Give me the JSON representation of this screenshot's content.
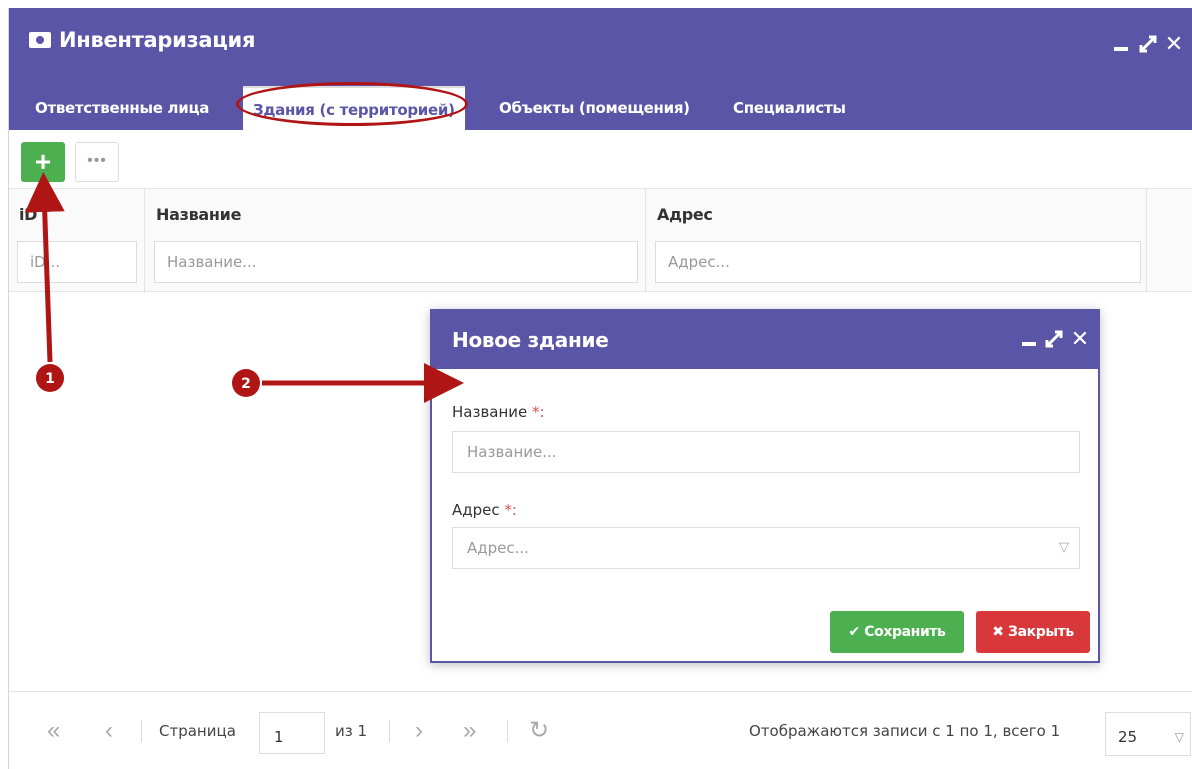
{
  "window": {
    "title": "Инвентаризация",
    "icon": "app-icon",
    "controls": [
      "minimize-icon",
      "maximize-icon",
      "close-icon"
    ]
  },
  "tabs": [
    {
      "label": "Ответственные лица",
      "active": false
    },
    {
      "label": "Здания (с территорией)",
      "active": true
    },
    {
      "label": "Объекты (помещения)",
      "active": false
    },
    {
      "label": "Специалисты",
      "active": false
    }
  ],
  "toolbar": {
    "add_label": "+",
    "more_label": "•••"
  },
  "grid": {
    "columns": [
      {
        "title": "iD",
        "filter_placeholder": "iD..."
      },
      {
        "title": "Название",
        "filter_placeholder": "Название..."
      },
      {
        "title": "Адрес",
        "filter_placeholder": "Адрес..."
      }
    ]
  },
  "dialog": {
    "title": "Новое здание",
    "fields": [
      {
        "label": "Название",
        "required": "*:",
        "placeholder": "Название..."
      },
      {
        "label": "Адрес",
        "required": "*:",
        "placeholder": "Адрес..."
      }
    ],
    "save_label": "✔ Сохранить",
    "close_label": "✖ Закрыть"
  },
  "pager": {
    "first": "«",
    "prev": "‹",
    "page_label": "Страница",
    "page_value": "1",
    "of_label": "из 1",
    "next": "›",
    "last": "»",
    "refresh": "↻",
    "records_text": "Отображаются записи с 1 по 1, всего 1",
    "per_page": "25"
  },
  "annotations": {
    "badge1": "1",
    "badge2": "2"
  },
  "colors": {
    "header": "#5b55a8",
    "green": "#4caf50",
    "red": "#d9383a",
    "annotation": "#b01515"
  }
}
